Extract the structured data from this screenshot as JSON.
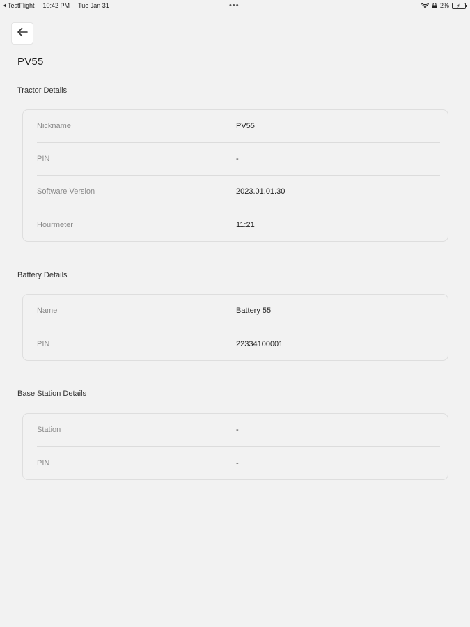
{
  "status_bar": {
    "back_app": "TestFlight",
    "time": "10:42 PM",
    "date": "Tue Jan 31",
    "dots": "•••",
    "battery_percent": "2%",
    "icons": [
      "wifi-icon",
      "lock-icon",
      "battery-icon"
    ]
  },
  "header": {
    "back_icon": "arrow-left-icon",
    "title": "PV55"
  },
  "sections": {
    "tractor": {
      "title": "Tractor Details",
      "rows": [
        {
          "label": "Nickname",
          "value": "PV55"
        },
        {
          "label": "PIN",
          "value": "-"
        },
        {
          "label": "Software Version",
          "value": "2023.01.01.30"
        },
        {
          "label": "Hourmeter",
          "value": "11:21"
        }
      ]
    },
    "battery": {
      "title": "Battery Details",
      "rows": [
        {
          "label": "Name",
          "value": "Battery 55"
        },
        {
          "label": "PIN",
          "value": "22334100001"
        }
      ]
    },
    "base_station": {
      "title": "Base Station Details",
      "rows": [
        {
          "label": "Station",
          "value": "-"
        },
        {
          "label": "PIN",
          "value": "-"
        }
      ]
    }
  }
}
